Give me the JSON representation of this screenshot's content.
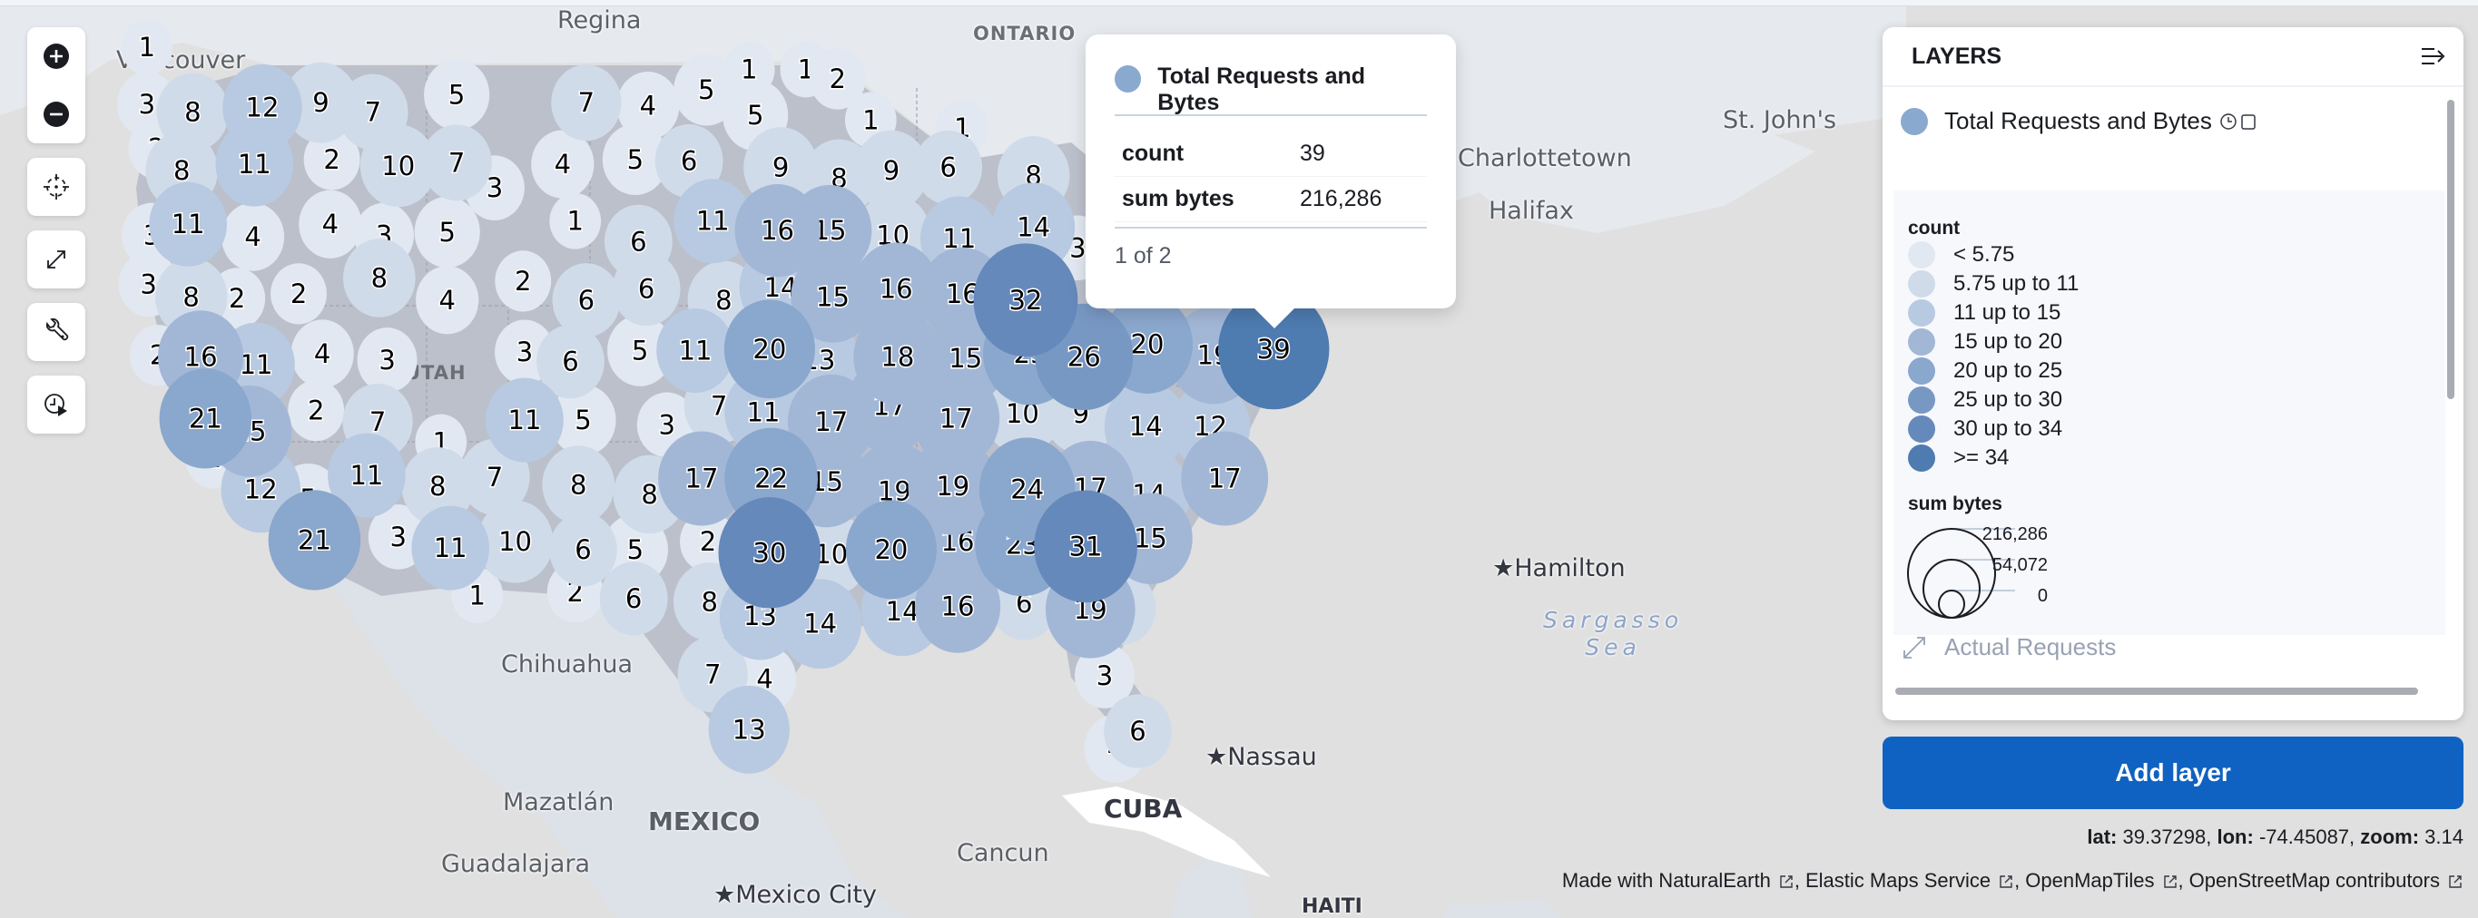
{
  "map": {
    "labels": {
      "regina": "Regina",
      "vancouver": "Vancouver",
      "ontario": "ONTARIO",
      "utah": "UTAH",
      "st_johns": "St. John's",
      "charlottetown": "Charlottetown",
      "halifax": "Halifax",
      "hamilton": "Hamilton",
      "sargasso": "Sargasso",
      "sea": "Sea",
      "chihuahua": "Chihuahua",
      "mazatlan": "Mazatlán",
      "mexico": "MEXICO",
      "guadalajara": "Guadalajara",
      "mexico_city": "Mexico City",
      "cancun": "Cancun",
      "cuba": "CUBA",
      "nassau": "Nassau",
      "haiti": "HAITI"
    },
    "clusters": [
      1,
      8,
      12,
      9,
      7,
      5,
      7,
      4,
      5,
      1,
      1,
      2,
      5,
      1,
      1,
      2,
      8,
      11,
      2,
      10,
      7,
      3,
      4,
      5,
      6,
      9,
      8,
      9,
      6,
      8,
      3,
      11,
      4,
      4,
      3,
      5,
      1,
      6,
      11,
      16,
      15,
      10,
      11,
      14,
      3,
      3,
      8,
      2,
      2,
      8,
      4,
      2,
      6,
      6,
      8,
      14,
      15,
      16,
      16,
      32,
      2,
      16,
      11,
      4,
      3,
      3,
      6,
      5,
      11,
      20,
      13,
      18,
      15,
      23,
      26,
      20,
      19,
      39,
      21,
      15,
      2,
      7,
      1,
      11,
      5,
      3,
      7,
      11,
      17,
      17,
      17,
      10,
      9,
      14,
      12,
      2,
      2,
      12,
      5,
      11,
      8,
      7,
      8,
      8,
      17,
      22,
      15,
      19,
      19,
      24,
      17,
      14,
      17,
      21,
      3,
      11,
      10,
      6,
      5,
      2,
      30,
      10,
      20,
      16,
      23,
      31,
      15,
      1,
      2,
      6,
      8,
      13,
      14,
      14,
      16,
      6,
      19,
      6,
      7,
      4,
      3,
      13,
      6,
      4,
      1,
      3,
      2
    ],
    "color_scale": [
      "#e2e8f1",
      "#d0dbea",
      "#b8cae1",
      "#a2b7d6",
      "#8aa7cd",
      "#7898c4",
      "#6689bb",
      "#4e7bb0"
    ]
  },
  "controls": {
    "zoom_in": "zoom-in",
    "zoom_out": "zoom-out",
    "fit": "fit-to-data",
    "fullscreen": "fullscreen",
    "tools": "tools",
    "timeslider": "timeslider"
  },
  "tooltip": {
    "layer_name": "Total Requests and Bytes",
    "rows": [
      {
        "key": "count",
        "value": "39"
      },
      {
        "key": "sum bytes",
        "value": "216,286"
      }
    ],
    "pager": "1 of 2"
  },
  "layers_panel": {
    "title": "LAYERS",
    "layers": [
      {
        "name": "Total Requests and Bytes",
        "color": "#8aa9cf"
      },
      {
        "name": "Actual Requests"
      }
    ],
    "legend": {
      "count_title": "count",
      "count_items": [
        {
          "label": "< 5.75",
          "color": "#e2e8f1"
        },
        {
          "label": "5.75 up to 11",
          "color": "#d0dbea"
        },
        {
          "label": "11 up to 15",
          "color": "#b8cae1"
        },
        {
          "label": "15 up to 20",
          "color": "#a2b7d6"
        },
        {
          "label": "20 up to 25",
          "color": "#8aa7cd"
        },
        {
          "label": "25 up to 30",
          "color": "#7898c4"
        },
        {
          "label": "30 up to 34",
          "color": "#6689bb"
        },
        {
          "label": ">= 34",
          "color": "#4e7bb0"
        }
      ],
      "size_title": "sum bytes",
      "size_values": [
        "216,286",
        "54,072",
        "0"
      ]
    },
    "add_layer_label": "Add layer"
  },
  "status": {
    "lat_label": "lat:",
    "lat": "39.37298,",
    "lon_label": "lon:",
    "lon": "-74.45087,",
    "zoom_label": "zoom:",
    "zoom": "3.14"
  },
  "attribution": [
    "Made with NaturalEarth",
    "Elastic Maps Service",
    "OpenMapTiles",
    "OpenStreetMap contributors"
  ]
}
